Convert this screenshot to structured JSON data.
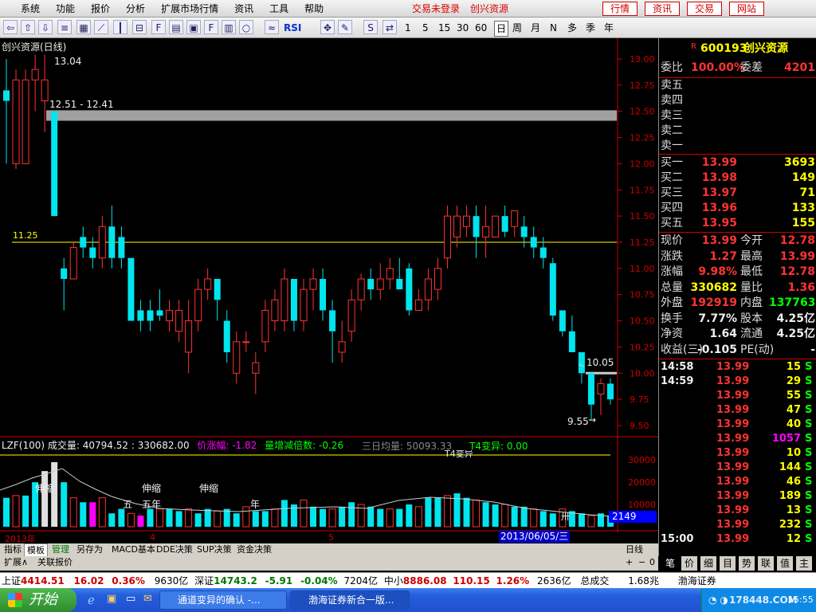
{
  "menu": {
    "items": [
      "系统",
      "功能",
      "报价",
      "分析",
      "扩展市场行情",
      "资讯",
      "工具",
      "帮助"
    ],
    "trade_status": "交易未登录",
    "stock_name": "创兴资源",
    "buttons": [
      "行情",
      "资讯",
      "交易",
      "网站"
    ]
  },
  "toolbar": {
    "periods": [
      "1",
      "5",
      "15",
      "30",
      "60",
      "日",
      "周",
      "月",
      "N",
      "多",
      "季",
      "年"
    ],
    "rsi": "RSI"
  },
  "chart": {
    "title": "创兴资源(日线)",
    "high_label": "13.04",
    "band_label": "12.51 - 12.41",
    "line_label": "11.25",
    "low_label": "9.55",
    "current_label": "10.05",
    "price_ticks": [
      "13.00",
      "12.75",
      "12.50",
      "12.25",
      "12.00",
      "11.75",
      "11.50",
      "11.25",
      "11.00",
      "10.75",
      "10.50",
      "10.25",
      "10.00",
      "9.75",
      "9.50"
    ],
    "vol_ticks": [
      "30000",
      "20000",
      "10000"
    ],
    "vol_header": {
      "name": "LZF(100)",
      "vol_label": "成交量: 40794.52 : 330682.00",
      "price_change": "价涨幅: -1.82",
      "vol_change": "量增减倍数: -0.26",
      "avg3": "三日均量: 50093.33",
      "t4": "T4变异: 0.00",
      "t4_cut": "T4变异"
    },
    "vol_annotations": [
      "伸缩",
      "伸缩",
      "伸缩",
      "五",
      "五年",
      "年"
    ],
    "vol_last": "2149",
    "vol_tag": "卅",
    "date_year": "2013年",
    "date_marks": [
      "4",
      "5"
    ],
    "date_cursor": "2013/06/05/三",
    "period_label": "日线"
  },
  "chart_data": {
    "type": "candlestick",
    "symbol": "600193",
    "candles": [
      [
        12.7,
        12.6,
        13.0,
        12.0
      ],
      [
        12.0,
        12.8,
        12.9,
        11.95
      ],
      [
        12.0,
        12.8,
        12.9,
        12.0
      ],
      [
        12.8,
        12.9,
        13.04,
        12.5
      ],
      [
        12.6,
        12.8,
        13.04,
        12.3
      ],
      [
        12.5,
        11.5,
        12.5,
        11.5
      ],
      [
        11.0,
        10.9,
        11.1,
        10.6
      ],
      [
        10.9,
        11.2,
        11.25,
        10.9
      ],
      [
        11.3,
        11.2,
        11.4,
        11.1
      ],
      [
        11.2,
        11.1,
        11.3,
        11.0
      ],
      [
        11.1,
        11.4,
        11.5,
        11.0
      ],
      [
        11.4,
        11.1,
        11.6,
        11.0
      ],
      [
        11.3,
        11.1,
        11.4,
        11.0
      ],
      [
        11.1,
        10.5,
        11.1,
        10.5
      ],
      [
        10.6,
        10.5,
        10.7,
        10.4
      ],
      [
        10.6,
        10.5,
        10.7,
        10.4
      ],
      [
        10.6,
        10.55,
        10.8,
        10.5
      ],
      [
        10.5,
        10.6,
        10.7,
        10.4
      ],
      [
        10.4,
        10.6,
        10.7,
        10.3
      ],
      [
        10.2,
        10.5,
        10.7,
        10.0
      ],
      [
        10.5,
        10.8,
        10.9,
        10.4
      ],
      [
        10.8,
        10.9,
        11.0,
        10.7
      ],
      [
        10.9,
        10.7,
        10.9,
        10.5
      ],
      [
        10.5,
        10.2,
        10.6,
        10.1
      ],
      [
        10.0,
        10.3,
        10.4,
        9.9
      ],
      [
        10.3,
        10.3,
        10.4,
        10.2
      ],
      [
        10.0,
        10.1,
        10.2,
        9.8
      ],
      [
        10.3,
        10.6,
        10.7,
        10.2
      ],
      [
        10.5,
        10.7,
        10.8,
        10.4
      ],
      [
        10.5,
        10.9,
        11.0,
        10.4
      ],
      [
        10.9,
        10.5,
        10.9,
        10.4
      ],
      [
        10.5,
        10.8,
        10.9,
        10.4
      ],
      [
        10.8,
        10.9,
        11.0,
        10.6
      ],
      [
        10.9,
        10.6,
        11.0,
        10.5
      ],
      [
        10.6,
        10.4,
        10.7,
        10.1
      ],
      [
        10.2,
        10.3,
        10.5,
        10.1
      ],
      [
        10.4,
        10.7,
        10.8,
        10.3
      ],
      [
        10.7,
        10.9,
        10.95,
        10.6
      ],
      [
        10.9,
        10.8,
        11.0,
        10.7
      ],
      [
        10.8,
        10.9,
        11.05,
        10.7
      ],
      [
        10.9,
        11.0,
        11.1,
        10.8
      ],
      [
        10.9,
        10.8,
        11.1,
        10.8
      ],
      [
        11.0,
        10.6,
        11.05,
        10.55
      ],
      [
        10.6,
        10.7,
        10.8,
        10.6
      ],
      [
        10.7,
        10.9,
        11.0,
        10.6
      ],
      [
        10.8,
        11.0,
        11.1,
        10.7
      ],
      [
        11.1,
        11.5,
        11.6,
        11.0
      ],
      [
        11.3,
        11.5,
        11.6,
        11.2
      ],
      [
        11.4,
        11.5,
        11.6,
        11.3
      ],
      [
        11.5,
        11.3,
        11.6,
        11.1
      ],
      [
        11.3,
        11.4,
        11.6,
        11.1
      ],
      [
        11.3,
        11.5,
        11.5,
        11.3
      ],
      [
        11.5,
        11.35,
        11.6,
        11.3
      ],
      [
        11.4,
        11.55,
        11.55,
        11.3
      ],
      [
        11.4,
        11.3,
        11.5,
        11.2
      ],
      [
        11.3,
        11.2,
        11.4,
        11.1
      ],
      [
        11.2,
        11.1,
        11.3,
        11.0
      ],
      [
        11.05,
        10.55,
        11.1,
        10.5
      ],
      [
        10.6,
        10.4,
        10.6,
        10.35
      ],
      [
        10.4,
        10.2,
        10.55,
        10.2
      ],
      [
        10.2,
        10.0,
        10.2,
        9.9
      ],
      [
        10.0,
        9.7,
        10.0,
        9.55
      ],
      [
        9.8,
        9.9,
        9.95,
        9.6
      ],
      [
        9.9,
        9.75,
        9.95,
        9.7
      ]
    ],
    "volume": [
      13000,
      14000,
      14000,
      20000,
      25000,
      29000,
      20000,
      13000,
      11000,
      11000,
      13000,
      6000,
      8000,
      6000,
      5000,
      8000,
      8000,
      8000,
      7000,
      8000,
      6000,
      8000,
      7000,
      8000,
      6000,
      9000,
      7000,
      7000,
      8000,
      12000,
      10000,
      12000,
      9000,
      8000,
      8000,
      9000,
      11000,
      10000,
      9000,
      8000,
      8000,
      8000,
      10000,
      9000,
      13000,
      13000,
      14000,
      15000,
      13000,
      12000,
      11000,
      10000,
      10000,
      9000,
      9000,
      8000,
      7000,
      6000,
      8000,
      7000,
      6000,
      5000,
      6000,
      5000
    ],
    "price_range": [
      9.5,
      13.0
    ],
    "horizontal_line": 11.25,
    "band": [
      12.41,
      12.51
    ]
  },
  "quote": {
    "code": "600193",
    "name": "创兴资源",
    "ratio_label": "委比",
    "ratio_value": "100.00%",
    "diff_label": "委差",
    "diff_value": "4201",
    "sell_labels": [
      "卖五",
      "卖四",
      "卖三",
      "卖二",
      "卖一"
    ],
    "buy": [
      {
        "label": "买一",
        "price": "13.99",
        "vol": "3693"
      },
      {
        "label": "买二",
        "price": "13.98",
        "vol": "149"
      },
      {
        "label": "买三",
        "price": "13.97",
        "vol": "71"
      },
      {
        "label": "买四",
        "price": "13.96",
        "vol": "133"
      },
      {
        "label": "买五",
        "price": "13.95",
        "vol": "155"
      }
    ],
    "stats": [
      {
        "l1": "现价",
        "v1": "13.99",
        "l2": "今开",
        "v2": "12.78"
      },
      {
        "l1": "涨跌",
        "v1": "1.27",
        "l2": "最高",
        "v2": "13.99"
      },
      {
        "l1": "涨幅",
        "v1": "9.98%",
        "l2": "最低",
        "v2": "12.78"
      },
      {
        "l1": "总量",
        "v1": "330682",
        "l2": "量比",
        "v2": "1.36"
      },
      {
        "l1": "外盘",
        "v1": "192919",
        "l2": "内盘",
        "v2": "137763"
      },
      {
        "l1": "换手",
        "v1": "7.77%",
        "l2": "股本",
        "v2": "4.25亿"
      },
      {
        "l1": "净资",
        "v1": "1.64",
        "l2": "流通",
        "v2": "4.25亿"
      },
      {
        "l1": "收益(三)",
        "v1": "-0.105",
        "l2": "PE(动)",
        "v2": "-"
      }
    ],
    "ticks": [
      {
        "time": "14:58",
        "price": "13.99",
        "vol": "15",
        "side": "S"
      },
      {
        "time": "14:59",
        "price": "13.99",
        "vol": "29",
        "side": "S"
      },
      {
        "time": "",
        "price": "13.99",
        "vol": "55",
        "side": "S"
      },
      {
        "time": "",
        "price": "13.99",
        "vol": "47",
        "side": "S"
      },
      {
        "time": "",
        "price": "13.99",
        "vol": "40",
        "side": "S"
      },
      {
        "time": "",
        "price": "13.99",
        "vol": "1057",
        "side": "S"
      },
      {
        "time": "",
        "price": "13.99",
        "vol": "10",
        "side": "S"
      },
      {
        "time": "",
        "price": "13.99",
        "vol": "144",
        "side": "S"
      },
      {
        "time": "",
        "price": "13.99",
        "vol": "46",
        "side": "S"
      },
      {
        "time": "",
        "price": "13.99",
        "vol": "189",
        "side": "S"
      },
      {
        "time": "",
        "price": "13.99",
        "vol": "13",
        "side": "S"
      },
      {
        "time": "",
        "price": "13.99",
        "vol": "232",
        "side": "S"
      },
      {
        "time": "15:00",
        "price": "13.99",
        "vol": "12",
        "side": "S"
      }
    ],
    "bottom_tabs": [
      "笔",
      "价",
      "细",
      "目",
      "势",
      "联",
      "值",
      "主"
    ]
  },
  "tabs": {
    "items": [
      "指标",
      "模板",
      "管理",
      "另存为",
      "MACD基本",
      "DDE决策",
      "SUP决策",
      "资金决策"
    ],
    "low": [
      "扩展∧",
      "关联报价"
    ]
  },
  "index_bar": {
    "sh_label": "上证",
    "sh_val": "4414.51",
    "sh_chg": "16.02",
    "sh_pct": "0.36%",
    "sh_amt": "9630亿",
    "sz_label": "深证",
    "sz_val": "14743.2",
    "sz_chg": "-5.91",
    "sz_pct": "-0.04%",
    "sz_amt": "7204亿",
    "zx_label": "中小",
    "zx_val": "8886.08",
    "zx_chg": "110.15",
    "zx_pct": "1.26%",
    "zx_amt": "2636亿",
    "total_label": "总成交",
    "total_val": "1.68兆",
    "broker": "渤海证券"
  },
  "taskbar": {
    "start": "开始",
    "task1": "通道变异的确认 -...",
    "task2": "渤海证券新合一版...",
    "watermark": "178448.COM",
    "time": "15:55"
  }
}
